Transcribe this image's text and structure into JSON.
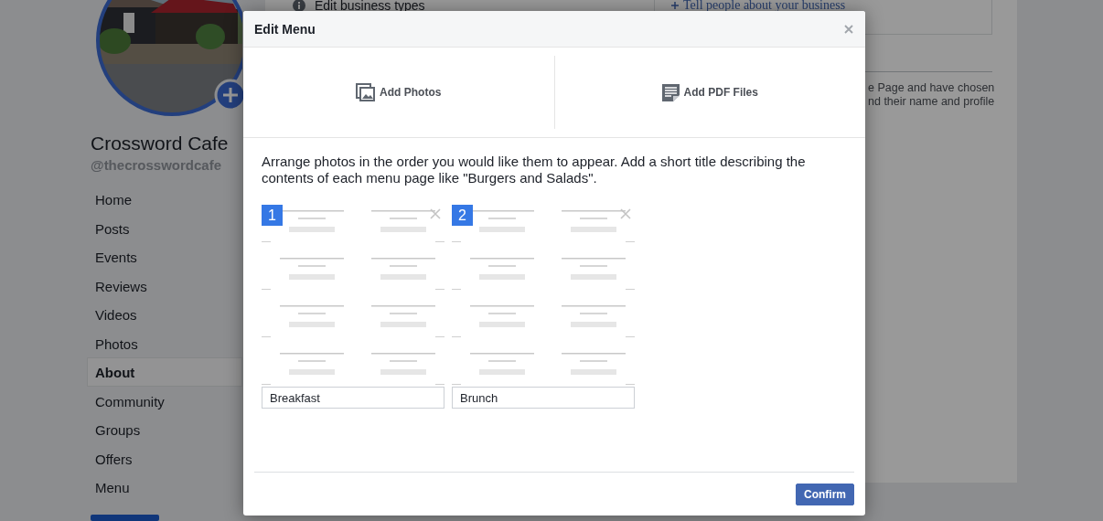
{
  "page": {
    "name": "Crossword Cafe",
    "handle": "@thecrosswordcafe",
    "nav": [
      {
        "label": "Home",
        "selected": false
      },
      {
        "label": "Posts",
        "selected": false
      },
      {
        "label": "Events",
        "selected": false
      },
      {
        "label": "Reviews",
        "selected": false
      },
      {
        "label": "Videos",
        "selected": false
      },
      {
        "label": "Photos",
        "selected": false
      },
      {
        "label": "About",
        "selected": true
      },
      {
        "label": "Community",
        "selected": false
      },
      {
        "label": "Groups",
        "selected": false
      },
      {
        "label": "Offers",
        "selected": false
      },
      {
        "label": "Menu",
        "selected": false
      }
    ],
    "about_item": "Edit business types",
    "info_link": "Tell people about your business",
    "note_lines": [
      "e Page and have chosen",
      "nd their name and profile"
    ]
  },
  "dialog": {
    "title": "Edit Menu",
    "options": [
      {
        "kind": "photos",
        "label": "Add Photos"
      },
      {
        "kind": "pdf",
        "label": "Add PDF Files"
      }
    ],
    "instructions": "Arrange photos in the order you would like them to appear. Add a short title describing the contents of each menu page like \"Burgers and Salads\".",
    "pages": [
      {
        "number": "1",
        "title": "Breakfast"
      },
      {
        "number": "2",
        "title": "Brunch"
      }
    ],
    "confirm": "Confirm"
  }
}
